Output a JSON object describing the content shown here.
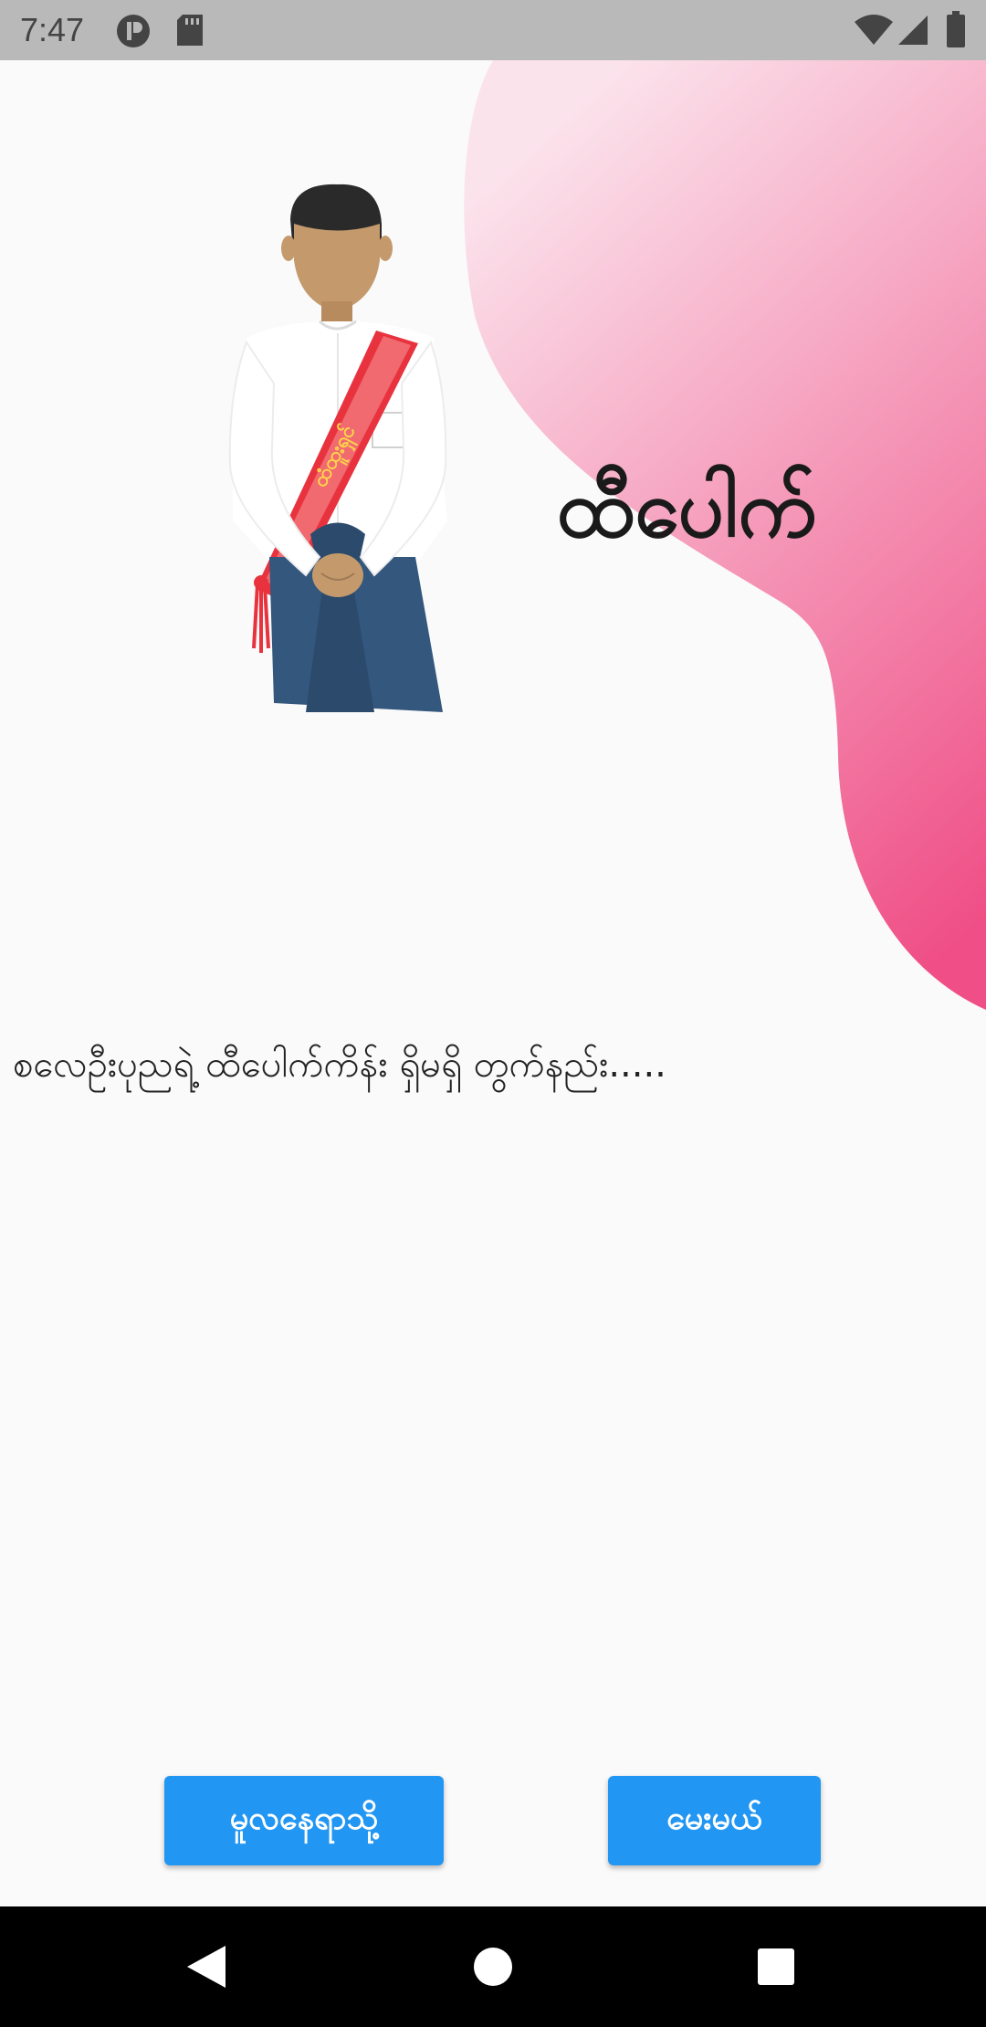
{
  "status_bar": {
    "time": "7:47"
  },
  "hero": {
    "title": "ထီပေါက်",
    "sash_text": "ထံထူးရှင်"
  },
  "main": {
    "message": "စလေဦးပုညရဲ့ ထီပေါက်ကိန်း ရှိမရှိ တွက်နည်း....."
  },
  "buttons": {
    "home_label": "မူလနေရာသို့",
    "ask_label": "မေးမယ်"
  },
  "colors": {
    "accent": "#2196f3",
    "blob_light": "#fbe3ec",
    "blob_dark": "#ef4f86",
    "sash": "#e8333f"
  },
  "icons": {
    "status": [
      "app-icon",
      "sd-card-icon",
      "wifi-icon",
      "signal-icon",
      "battery-icon"
    ],
    "nav": [
      "back-icon",
      "home-icon",
      "recents-icon"
    ]
  }
}
